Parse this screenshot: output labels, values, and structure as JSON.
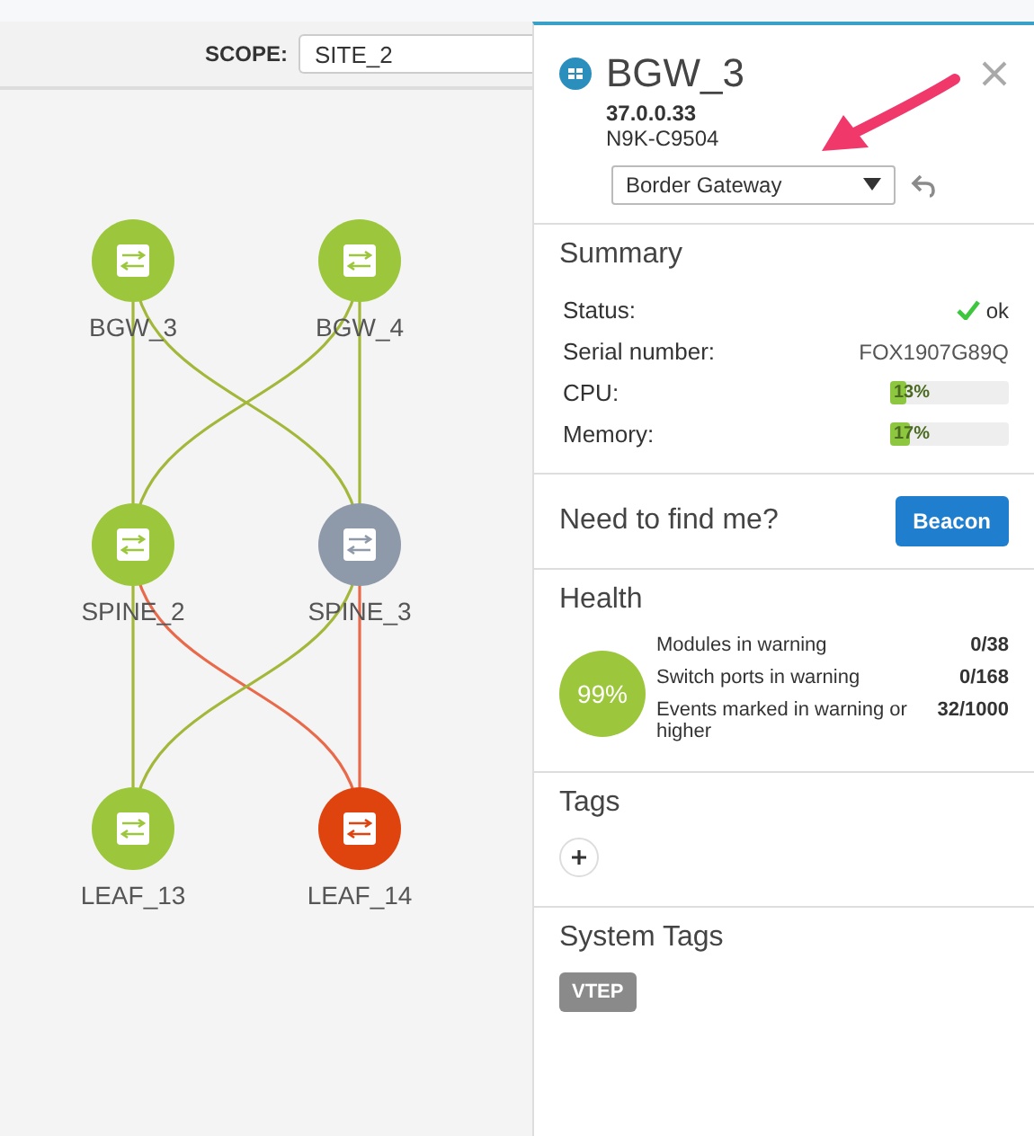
{
  "scope": {
    "label": "SCOPE:",
    "value": "SITE_2"
  },
  "topology": {
    "nodes": [
      {
        "name": "BGW_3",
        "color": "#9cc73d"
      },
      {
        "name": "BGW_4",
        "color": "#9cc73d"
      },
      {
        "name": "SPINE_2",
        "color": "#9cc73d"
      },
      {
        "name": "SPINE_3",
        "color": "#8e99a9"
      },
      {
        "name": "LEAF_13",
        "color": "#9cc73d"
      },
      {
        "name": "LEAF_14",
        "color": "#e0440e"
      }
    ]
  },
  "panel": {
    "title": "BGW_3",
    "ip": "37.0.0.33",
    "model": "N9K-C9504",
    "role": "Border Gateway",
    "summary": {
      "title": "Summary",
      "status_label": "Status:",
      "status_value": "ok",
      "serial_label": "Serial number:",
      "serial_value": "FOX1907G89Q",
      "meters": [
        {
          "label": "CPU:",
          "level": 0.13,
          "reading": "13%"
        },
        {
          "label": "Memory:",
          "level": 0.17,
          "reading": "17%"
        }
      ]
    },
    "beacon": {
      "text": "Need to find me?",
      "button": "Beacon"
    },
    "health": {
      "title": "Health",
      "score": "99%",
      "rows": [
        {
          "label": "Modules in warning",
          "value": "0/38"
        },
        {
          "label": "Switch ports in warning",
          "value": "0/168"
        },
        {
          "label": "Events marked in warning or higher",
          "value": "32/1000"
        }
      ]
    },
    "tags": {
      "title": "Tags"
    },
    "system_tags": {
      "title": "System Tags",
      "items": [
        "VTEP"
      ]
    }
  }
}
